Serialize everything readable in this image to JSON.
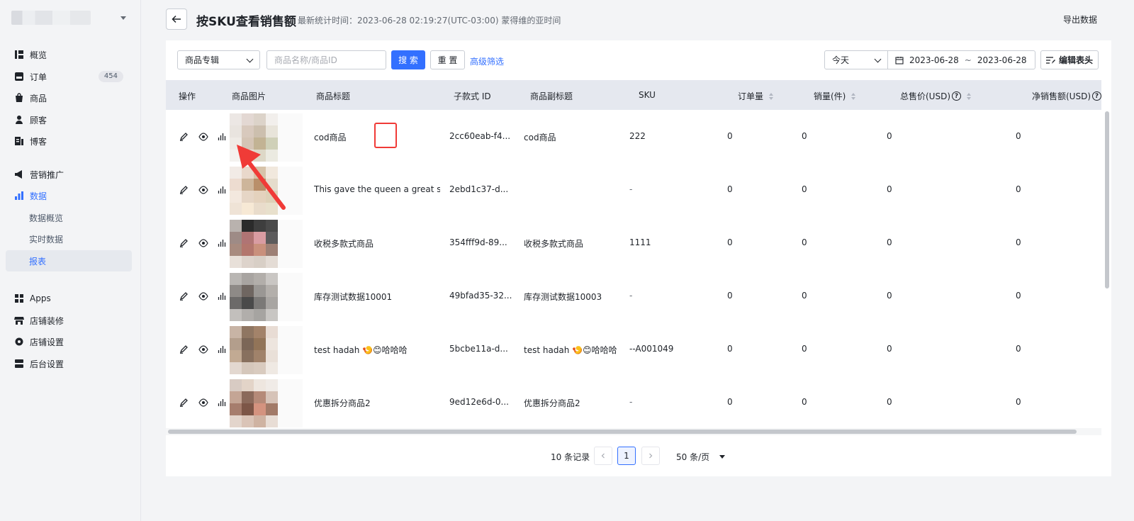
{
  "sidebar": {
    "items": [
      {
        "label": "概览",
        "icon": "overview-icon"
      },
      {
        "label": "订单",
        "icon": "order-icon",
        "badge": "454"
      },
      {
        "label": "商品",
        "icon": "product-icon"
      },
      {
        "label": "顾客",
        "icon": "customer-icon"
      },
      {
        "label": "博客",
        "icon": "blog-icon"
      },
      {
        "label": "营销推广",
        "icon": "megaphone-icon"
      },
      {
        "label": "数据",
        "icon": "bar-chart-icon"
      },
      {
        "label": "数据概览"
      },
      {
        "label": "实时数据"
      },
      {
        "label": "报表"
      },
      {
        "label": "Apps",
        "icon": "apps-icon"
      },
      {
        "label": "店铺装修",
        "icon": "store-icon"
      },
      {
        "label": "店铺设置",
        "icon": "settings-icon"
      },
      {
        "label": "后台设置",
        "icon": "server-icon"
      }
    ]
  },
  "header": {
    "title": "按SKU查看销售额",
    "stat_time": "最新统计时间：2023-06-28 02:19:27(UTC-03:00) 蒙得维的亚时间",
    "export": "导出数据"
  },
  "filters": {
    "category_select": "商品专辑",
    "search_placeholder": "商品名称/商品ID",
    "search_btn": "搜 索",
    "reset_btn": "重 置",
    "advanced": "高级筛选",
    "period_select": "今天",
    "date_start": "2023-06-28",
    "date_sep": "~",
    "date_end": "2023-06-28",
    "edit_header": "编辑表头"
  },
  "table": {
    "headers": {
      "ops": "操作",
      "image": "商品图片",
      "title": "商品标题",
      "variant_id": "子款式 ID",
      "subtitle": "商品副标题",
      "sku": "SKU",
      "orders": "订单量",
      "sales": "销量(件)",
      "total_price": "总售价(USD)",
      "net_sales": "净销售额(USD)"
    },
    "rows": [
      {
        "title": "cod商品",
        "variant_id": "2cc60eab-f4...",
        "subtitle": "cod商品",
        "sku": "222",
        "orders": "0",
        "sales": "0",
        "total_price": "0",
        "net_sales": "0"
      },
      {
        "title": "This gave the queen a great sh...",
        "variant_id": "2ebd1c37-d...",
        "subtitle": "",
        "sku": "-",
        "orders": "0",
        "sales": "0",
        "total_price": "0",
        "net_sales": "0"
      },
      {
        "title": "收税多款式商品",
        "variant_id": "354fff9d-89...",
        "subtitle": "收税多款式商品",
        "sku": "1111",
        "orders": "0",
        "sales": "0",
        "total_price": "0",
        "net_sales": "0"
      },
      {
        "title": "库存测试数据10001",
        "variant_id": "49bfad35-32...",
        "subtitle": "库存测试数据10003",
        "sku": "-",
        "orders": "0",
        "sales": "0",
        "total_price": "0",
        "net_sales": "0"
      },
      {
        "title": "test hadah 🍤😊哈哈哈",
        "variant_id": "5bcbe11a-d...",
        "subtitle": "test hadah 🍤😊哈哈哈",
        "sku": "--A001049",
        "orders": "0",
        "sales": "0",
        "total_price": "0",
        "net_sales": "0"
      },
      {
        "title": "优惠拆分商品2",
        "variant_id": "9ed12e6d-0...",
        "subtitle": "优惠拆分商品2",
        "sku": "-",
        "orders": "0",
        "sales": "0",
        "total_price": "0",
        "net_sales": "0"
      }
    ]
  },
  "pagination": {
    "total": "10 条记录",
    "current": "1",
    "per_page": "50 条/页"
  },
  "colors": {
    "primary": "#3370ff",
    "annotation": "#f03b37"
  }
}
